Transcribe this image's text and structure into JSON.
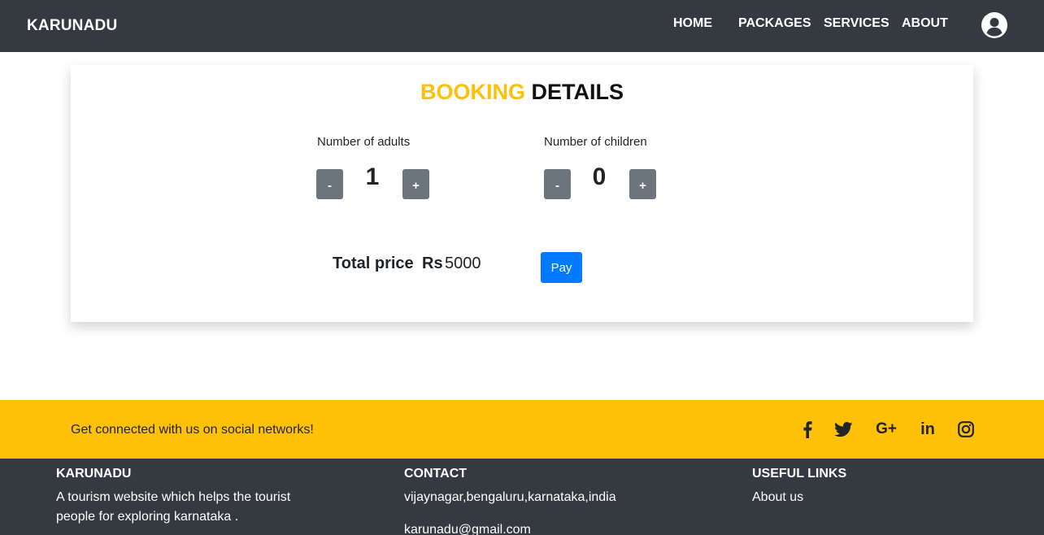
{
  "navbar": {
    "brand": "KARUNADU",
    "links": [
      "HOME",
      "PACKAGES",
      "SERVICES",
      "ABOUT"
    ],
    "profile_icon": "user-circle-icon"
  },
  "booking": {
    "title_highlight": "BOOKING",
    "title_rest": "DETAILS",
    "adults": {
      "label": "Number of adults",
      "value": "1",
      "minus": "-",
      "plus": "+"
    },
    "children": {
      "label": "Number of children",
      "value": "0",
      "minus": "-",
      "plus": "+"
    },
    "total_label": "Total price",
    "currency": "Rs",
    "total_value": "5000",
    "pay_label": "Pay"
  },
  "social": {
    "text": "Get connected with us on social networks!",
    "icons": [
      "facebook-icon",
      "twitter-icon",
      "google-plus-icon",
      "linkedin-icon",
      "instagram-icon"
    ]
  },
  "footer": {
    "col1": {
      "heading": "KARUNADU",
      "text": "A tourism website which helps the tourist people for exploring karnataka ."
    },
    "col2": {
      "heading": "CONTACT",
      "address": "vijaynagar,bengaluru,karnataka,india",
      "email": "karunadu@gmail.com"
    },
    "col3": {
      "heading": "USEFUL LINKS",
      "links": [
        "About us"
      ]
    }
  },
  "colors": {
    "navbar_bg": "#343a40",
    "accent_yellow": "#ffc107",
    "stepper_gray": "#6c757d",
    "primary_blue": "#007bff"
  }
}
